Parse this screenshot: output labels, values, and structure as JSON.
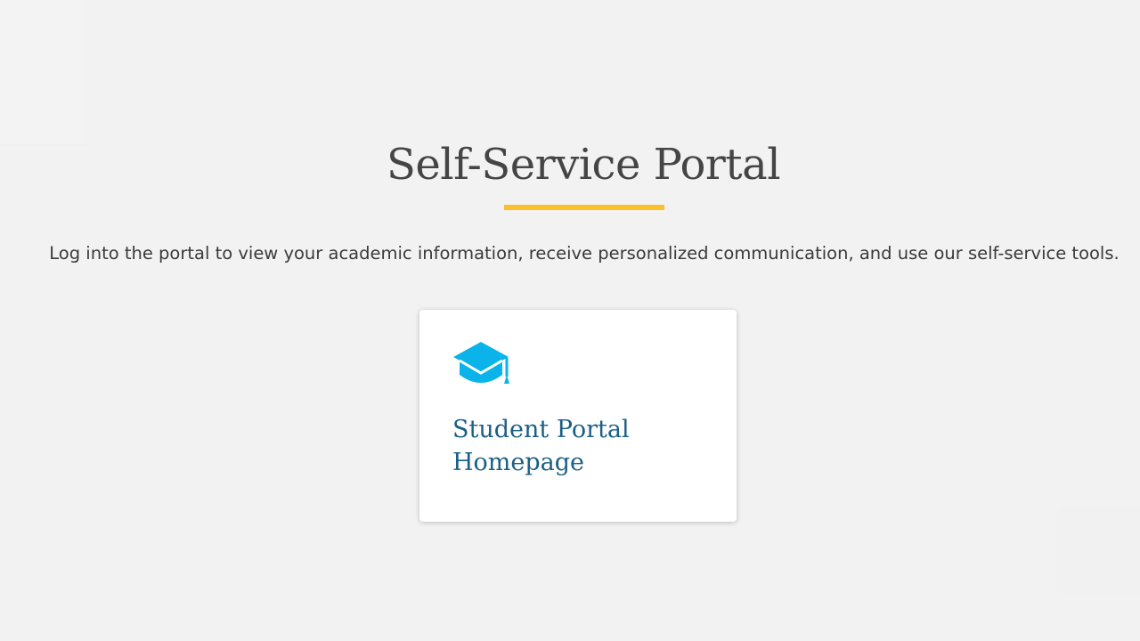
{
  "header": {
    "title": "Self-Service Portal"
  },
  "intro": {
    "text": "Log into the portal to view your academic information, receive personalized communication, and use our self-service tools."
  },
  "cards": [
    {
      "icon": "graduation-cap-icon",
      "label": "Student Portal Homepage"
    }
  ],
  "colors": {
    "background": "#f2f2f2",
    "accent_underline": "#fbc02d",
    "icon": "#0ab4ea",
    "card_label": "#1a5f86",
    "heading": "#454545"
  }
}
